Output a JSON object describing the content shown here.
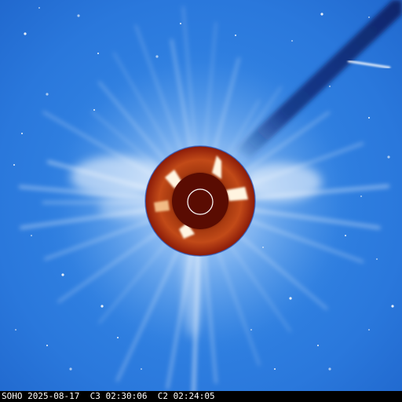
{
  "caption": {
    "observatory": "SOHO",
    "date": "2025-08-17",
    "c3_label": "C3",
    "c3_time": "02:30:06",
    "c2_label": "C2",
    "c2_time": "02:24:05"
  },
  "colors": {
    "sky": "#2f7fe0",
    "corona": "#ffffff",
    "occulter_c2": "#8a1a08",
    "occulter_c3": "#5a0c02",
    "bright_streamer": "#ffd8a0",
    "sun_outline": "#ffffff"
  }
}
